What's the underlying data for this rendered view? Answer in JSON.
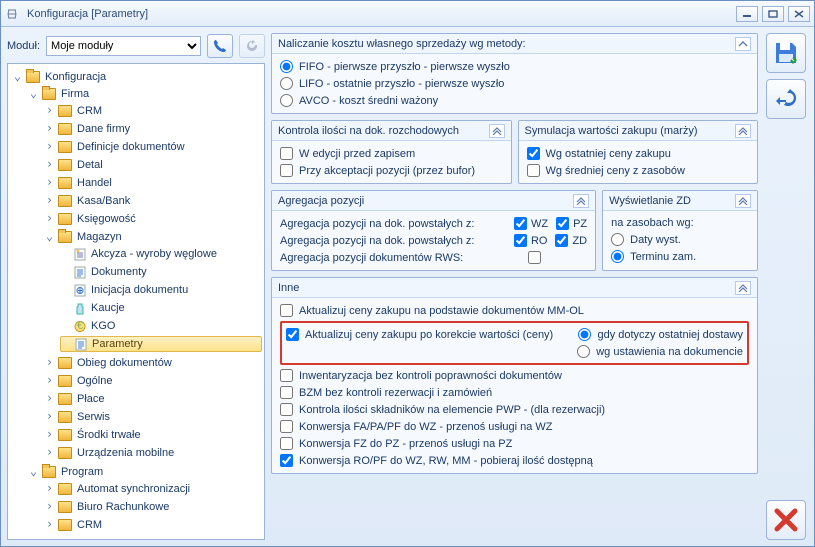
{
  "window": {
    "title": "Konfiguracja [Parametry]"
  },
  "toolbar": {
    "module_label": "Moduł:",
    "module_value": "Moje moduły"
  },
  "tree": {
    "root": "Konfiguracja",
    "firma": "Firma",
    "firma_children": {
      "crm": "CRM",
      "dane_firmy": "Dane firmy",
      "definicje": "Definicje dokumentów",
      "detal": "Detal",
      "handel": "Handel",
      "kasa_bank": "Kasa/Bank",
      "ksiegowosc": "Księgowość",
      "magazyn": "Magazyn",
      "magazyn_children": {
        "akcyza": "Akcyza - wyroby węglowe",
        "dokumenty": "Dokumenty",
        "inicjacja": "Inicjacja dokumentu",
        "kaucje": "Kaucje",
        "kgo": "KGO",
        "parametry": "Parametry"
      },
      "obieg": "Obieg dokumentów",
      "ogolne": "Ogólne",
      "place": "Płace",
      "serwis": "Serwis",
      "srodki": "Środki trwałe",
      "urzadzenia": "Urządzenia mobilne"
    },
    "program": "Program",
    "program_children": {
      "automat": "Automat synchronizacji",
      "biuro": "Biuro Rachunkowe",
      "crm2": "CRM"
    }
  },
  "panels": {
    "nalicz": {
      "title": "Naliczanie kosztu własnego sprzedaży wg metody:",
      "fifo": "FIFO - pierwsze przyszło - pierwsze wyszło",
      "lifo": "LIFO - ostatnie przyszło - pierwsze wyszło",
      "avco": "AVCO - koszt średni ważony"
    },
    "kontrola": {
      "title": "Kontrola ilości na dok. rozchodowych",
      "c1": "W edycji przed zapisem",
      "c2": "Przy akceptacji pozycji (przez bufor)"
    },
    "symulacja": {
      "title": "Symulacja wartości zakupu (marży)",
      "c1": "Wg ostatniej ceny zakupu",
      "c2": "Wg średniej ceny z zasobów"
    },
    "agregacja": {
      "title": "Agregacja pozycji",
      "l1": "Agregacja pozycji na dok. powstałych z:",
      "l1a": "WZ",
      "l1b": "PZ",
      "l2": "Agregacja pozycji na dok. powstałych z:",
      "l2a": "RO",
      "l2b": "ZD",
      "l3": "Agregacja pozycji dokumentów RWS:"
    },
    "wysw": {
      "title": "Wyświetlanie ZD",
      "sub": "na zasobach wg:",
      "r1": "Daty wyst.",
      "r2": "Terminu zam."
    },
    "inne": {
      "title": "Inne",
      "c1": "Aktualizuj ceny zakupu na podstawie dokumentów MM-OL",
      "c2": "Aktualizuj ceny zakupu po korekcie wartości (ceny)",
      "c2r1": "gdy dotyczy ostatniej dostawy",
      "c2r2": "wg ustawienia na dokumencie",
      "c3": "Inwentaryzacja bez kontroli poprawności dokumentów",
      "c4": "BZM bez kontroli rezerwacji i zamówień",
      "c5": "Kontrola ilości składników na elemencie PWP - (dla rezerwacji)",
      "c6": "Konwersja FA/PA/PF do WZ - przenoś usługi na WZ",
      "c7": "Konwersja FZ do PZ - przenoś usługi na PZ",
      "c8": "Konwersja RO/PF do WZ, RW, MM - pobieraj ilość dostępną"
    }
  }
}
